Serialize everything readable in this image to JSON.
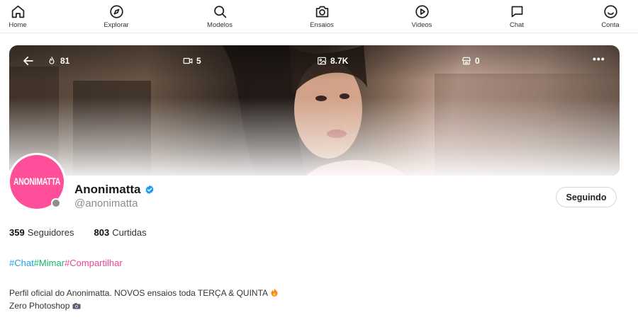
{
  "nav": {
    "items": [
      {
        "label": "Home",
        "icon": "home-icon"
      },
      {
        "label": "Explorar",
        "icon": "compass-icon"
      },
      {
        "label": "Modelos",
        "icon": "search-icon"
      },
      {
        "label": "Ensaios",
        "icon": "camera-icon"
      },
      {
        "label": "Videos",
        "icon": "play-circle-icon"
      },
      {
        "label": "Chat",
        "icon": "message-square-icon"
      },
      {
        "label": "Conta",
        "icon": "smile-icon"
      }
    ]
  },
  "cover": {
    "likes": "81",
    "videos": "5",
    "photos": "8.7K",
    "shop": "0"
  },
  "profile": {
    "avatar_text": "ANONIMATTA",
    "name": "Anonimatta",
    "handle": "@anonimatta",
    "follow_label": "Seguindo"
  },
  "stats": {
    "followers_count": "359",
    "followers_label": "Seguidores",
    "likes_count": "803",
    "likes_label": "Curtidas"
  },
  "tags": [
    {
      "text": "#Chat",
      "color": "#1aa3e8"
    },
    {
      "text": "#Mimar",
      "color": "#19b86b"
    },
    {
      "text": "#Compartilhar",
      "color": "#f0448f"
    }
  ],
  "bio": {
    "line1": "Perfil oficial do Anonimatta. NOVOS ensaios toda TERÇA & QUINTA",
    "line2": "Zero Photoshop"
  },
  "colors": {
    "brand_pink": "#ff4f9b",
    "verified_blue": "#1d9bf0",
    "status_gray": "#8e8e8e"
  }
}
